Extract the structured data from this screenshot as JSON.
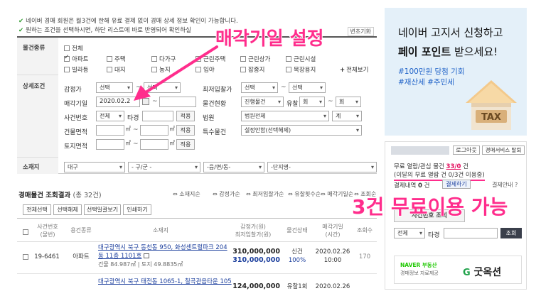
{
  "notice": {
    "line1": "네이버 경매 회원은 월3건에 한해 유료 결제 없이 경매 상세 정보 확인이 가능합니다.",
    "line2": "원하는 조건을 선택하시면, 하단 리스트에 바로 반영되어 확인하실",
    "reset_label": "변초기화"
  },
  "filter": {
    "type_label": "물건종류",
    "types": [
      {
        "label": "전체",
        "checked": false
      },
      {
        "label": "아파트",
        "checked": true
      },
      {
        "label": "주택",
        "checked": false
      },
      {
        "label": "다가구",
        "checked": false
      },
      {
        "label": "근린주택",
        "checked": false
      },
      {
        "label": "근린상가",
        "checked": false
      },
      {
        "label": "근린시설",
        "checked": false
      },
      {
        "label": "빌라등",
        "checked": false
      },
      {
        "label": "대지",
        "checked": false
      },
      {
        "label": "농지",
        "checked": false
      },
      {
        "label": "임야",
        "checked": false
      },
      {
        "label": "잡종지",
        "checked": false
      },
      {
        "label": "목장용지",
        "checked": false
      }
    ],
    "show_all": "전체보기",
    "detail_label": "상세조건",
    "appraisal_label": "감정가",
    "select_default": "선택",
    "min_bid_label": "최저입찰가",
    "sale_date_label": "매각기일",
    "sale_date_value": "2020.02.2",
    "status_label": "물건현황",
    "status_value": "진행물건",
    "failed_label": "유찰",
    "count_unit": "회",
    "case_label": "사건번호",
    "case_select": "전체",
    "case_year": "타경",
    "apply": "적용",
    "court_label": "법원",
    "court_value": "법원전체",
    "court_sub": "계",
    "building_area_label": "건물면적",
    "land_area_label": "토지면적",
    "area_unit": "㎡",
    "special_label": "특수물건",
    "special_value": "설정안함(선택해제)",
    "location_label": "소재지",
    "location_selects": [
      "대구",
      "- 구/군 -",
      "-읍/면/동-",
      "-단지명-"
    ]
  },
  "results": {
    "title": "경매물건 조회결과",
    "count": "(총 32건)",
    "sort_links": [
      "소재지순",
      "감정가순",
      "최저입찰가순",
      "유찰횟수순",
      "매각기일순",
      "조회순"
    ],
    "action_buttons": [
      "전체선택",
      "선택해제",
      "선택일괄보기",
      "인쇄하기"
    ],
    "headers": [
      "사건번호\n(물번)",
      "용건종류",
      "소재지",
      "감정가(원)\n최저입찰가(원)",
      "물건상태",
      "매각기일\n(시간)",
      "조회수"
    ],
    "rows": [
      {
        "case_no": "19-6461",
        "kind": "아파트",
        "addr1": "대구광역시 북구 동천동 950, 화성센트럴파크 204",
        "addr2": "동 11층 1101호",
        "area": "건물 84.987㎡ | 토지 49.8835㎡",
        "appraisal": "310,000,000",
        "min_bid": "310,000,000",
        "status": "신건",
        "rate": "100%",
        "date": "2020.02.26",
        "time": "10:00",
        "views": "170"
      },
      {
        "case_no": "",
        "kind": "",
        "addr1": "대구광역시 북구 태전동 1065-1, 칠곡관음타운 105",
        "appraisal": "124,000,000",
        "status": "유찰1회",
        "date": "2020.02.26"
      }
    ]
  },
  "ad": {
    "line1": "네이버 고지서 신청하고",
    "line2_bold": "페이 포인트",
    "line2_rest": " 받으세요!",
    "hashtag1": "#100만원 당첨 기회",
    "hashtag2": "#재산세 #주민세",
    "roof_text": "TAX"
  },
  "sidebar": {
    "login": "로그아웃",
    "service": "경매서비스 탈퇴",
    "views_text": "무료 열람/관심 물건",
    "views_count": "33/0",
    "views_unit": "건",
    "free_text": "(이달의 무료 열람 건 0/3건 이용중)",
    "payment_text": "결제내역",
    "payment_count": "0",
    "payment_unit": "건",
    "payment_btn": "결제하기",
    "payment_info": "결제안내 ?",
    "case_search_tab": "사건번호 조회",
    "case_select": "전체",
    "case_year": "타경",
    "search_btn": "조회",
    "naver_label": "NAVER 부동산",
    "naver_sub": "경매정보 자료제공",
    "partner": "굿옥션"
  },
  "annotations": {
    "sale_date": "매각기일 설정",
    "free_use": "3건 무료이용 가능"
  },
  "colors": {
    "annotation": "#ff2d8c",
    "link": "#1a3d9c",
    "ad_bg": "#e4f0f9",
    "ad_hashtag": "#1f62c8"
  }
}
